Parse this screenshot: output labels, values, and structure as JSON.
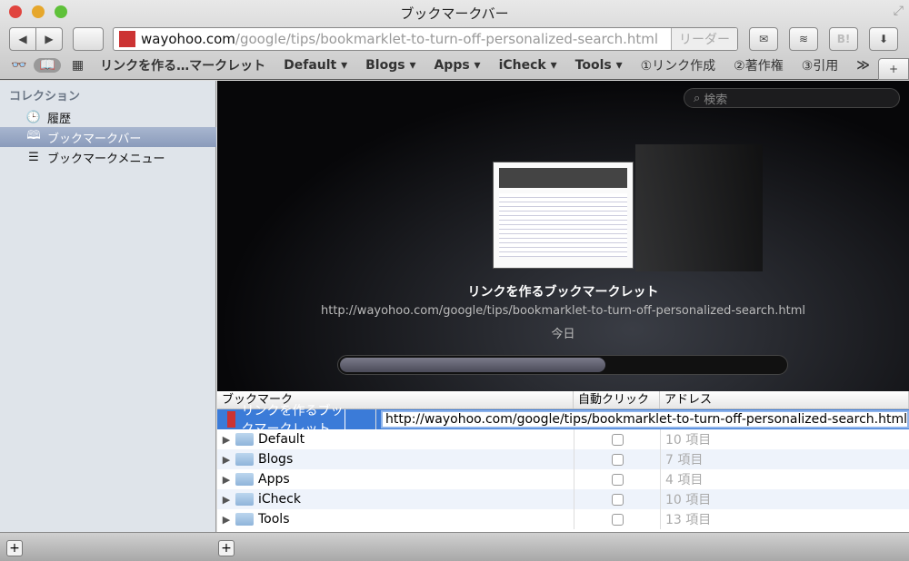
{
  "window": {
    "title": "ブックマークバー"
  },
  "toolbar": {
    "back": "◀",
    "forward": "▶",
    "url_host": "wayohoo.com",
    "url_path": "/google/tips/bookmarklet-to-turn-off-personalized-search.html",
    "reader": "リーダー",
    "icons": [
      "mail-icon",
      "layers-icon",
      "hatena-bookmark-icon",
      "download-icon"
    ],
    "hatena": "B!"
  },
  "bookmarks_bar": {
    "items": [
      "リンクを作る…マークレット",
      "Default ▾",
      "Blogs ▾",
      "Apps ▾",
      "iCheck ▾",
      "Tools ▾",
      "①リンク作成",
      "②著作権",
      "③引用"
    ],
    "more": "≫",
    "add": "+"
  },
  "sidebar": {
    "header": "コレクション",
    "items": [
      {
        "label": "履歴",
        "icon": "clock-icon"
      },
      {
        "label": "ブックマークバー",
        "icon": "book-icon"
      },
      {
        "label": "ブックマークメニュー",
        "icon": "menu-list-icon"
      }
    ]
  },
  "coverflow": {
    "search_placeholder": "検索",
    "title": "リンクを作るブックマークレット",
    "url": "http://wayohoo.com/google/tips/bookmarklet-to-turn-off-personalized-search.html",
    "date": "今日",
    "scroll_position_percent": 60
  },
  "table": {
    "columns": [
      "ブックマーク",
      "自動クリック",
      "アドレス"
    ],
    "rows": [
      {
        "name": "リンクを作るブックマークレット",
        "address": "http://wayohoo.com/google/tips/bookmarklet-to-turn-off-personalized-search.html",
        "selected": true
      },
      {
        "name": "Default",
        "address": "10 項目"
      },
      {
        "name": "Blogs",
        "address": "7 項目"
      },
      {
        "name": "Apps",
        "address": "4 項目"
      },
      {
        "name": "iCheck",
        "address": "10 項目"
      },
      {
        "name": "Tools",
        "address": "13 項目"
      }
    ]
  },
  "bottom": {
    "add": "+"
  }
}
